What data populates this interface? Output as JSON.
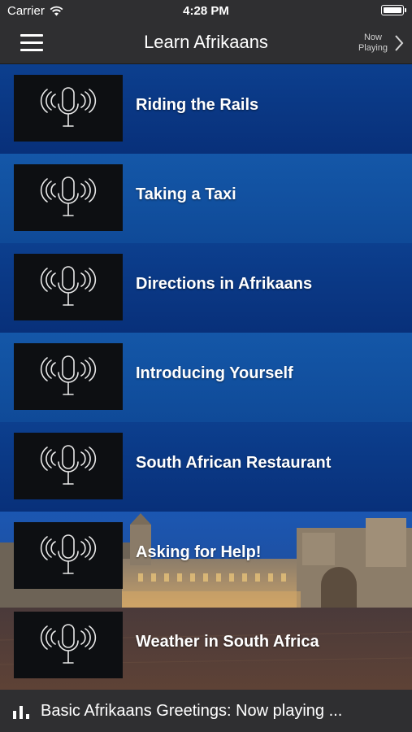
{
  "status_bar": {
    "carrier": "Carrier",
    "time": "4:28 PM"
  },
  "nav": {
    "title": "Learn Afrikaans",
    "now_playing_line1": "Now",
    "now_playing_line2": "Playing"
  },
  "lessons": [
    {
      "title": "Riding the Rails"
    },
    {
      "title": "Taking a Taxi"
    },
    {
      "title": "Directions in Afrikaans"
    },
    {
      "title": "Introducing Yourself"
    },
    {
      "title": "South African Restaurant"
    },
    {
      "title": "Asking for Help!"
    },
    {
      "title": "Weather in South Africa"
    }
  ],
  "player": {
    "text": "Basic Afrikaans Greetings: Now playing ..."
  },
  "colors": {
    "bar": "#2f2f31",
    "row_dark": "#0c3f8e",
    "row_light": "#1457a8",
    "thumb": "#0d0f12"
  },
  "icons": [
    "menu-icon",
    "chevron-right-icon",
    "microphone-icon",
    "wifi-icon",
    "battery-icon",
    "audio-bars-icon"
  ]
}
